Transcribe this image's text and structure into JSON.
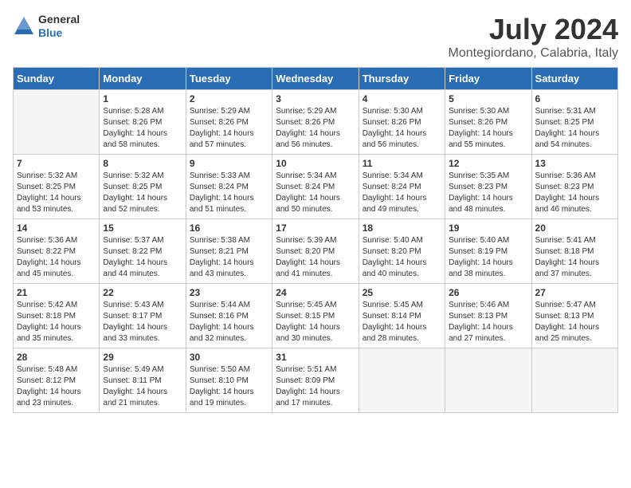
{
  "header": {
    "logo_general": "General",
    "logo_blue": "Blue",
    "main_title": "July 2024",
    "subtitle": "Montegiordano, Calabria, Italy"
  },
  "days_of_week": [
    "Sunday",
    "Monday",
    "Tuesday",
    "Wednesday",
    "Thursday",
    "Friday",
    "Saturday"
  ],
  "weeks": [
    [
      {
        "day": "",
        "sunrise": "",
        "sunset": "",
        "daylight": "",
        "empty": true
      },
      {
        "day": "1",
        "sunrise": "Sunrise: 5:28 AM",
        "sunset": "Sunset: 8:26 PM",
        "daylight": "Daylight: 14 hours and 58 minutes."
      },
      {
        "day": "2",
        "sunrise": "Sunrise: 5:29 AM",
        "sunset": "Sunset: 8:26 PM",
        "daylight": "Daylight: 14 hours and 57 minutes."
      },
      {
        "day": "3",
        "sunrise": "Sunrise: 5:29 AM",
        "sunset": "Sunset: 8:26 PM",
        "daylight": "Daylight: 14 hours and 56 minutes."
      },
      {
        "day": "4",
        "sunrise": "Sunrise: 5:30 AM",
        "sunset": "Sunset: 8:26 PM",
        "daylight": "Daylight: 14 hours and 56 minutes."
      },
      {
        "day": "5",
        "sunrise": "Sunrise: 5:30 AM",
        "sunset": "Sunset: 8:26 PM",
        "daylight": "Daylight: 14 hours and 55 minutes."
      },
      {
        "day": "6",
        "sunrise": "Sunrise: 5:31 AM",
        "sunset": "Sunset: 8:25 PM",
        "daylight": "Daylight: 14 hours and 54 minutes."
      }
    ],
    [
      {
        "day": "7",
        "sunrise": "Sunrise: 5:32 AM",
        "sunset": "Sunset: 8:25 PM",
        "daylight": "Daylight: 14 hours and 53 minutes."
      },
      {
        "day": "8",
        "sunrise": "Sunrise: 5:32 AM",
        "sunset": "Sunset: 8:25 PM",
        "daylight": "Daylight: 14 hours and 52 minutes."
      },
      {
        "day": "9",
        "sunrise": "Sunrise: 5:33 AM",
        "sunset": "Sunset: 8:24 PM",
        "daylight": "Daylight: 14 hours and 51 minutes."
      },
      {
        "day": "10",
        "sunrise": "Sunrise: 5:34 AM",
        "sunset": "Sunset: 8:24 PM",
        "daylight": "Daylight: 14 hours and 50 minutes."
      },
      {
        "day": "11",
        "sunrise": "Sunrise: 5:34 AM",
        "sunset": "Sunset: 8:24 PM",
        "daylight": "Daylight: 14 hours and 49 minutes."
      },
      {
        "day": "12",
        "sunrise": "Sunrise: 5:35 AM",
        "sunset": "Sunset: 8:23 PM",
        "daylight": "Daylight: 14 hours and 48 minutes."
      },
      {
        "day": "13",
        "sunrise": "Sunrise: 5:36 AM",
        "sunset": "Sunset: 8:23 PM",
        "daylight": "Daylight: 14 hours and 46 minutes."
      }
    ],
    [
      {
        "day": "14",
        "sunrise": "Sunrise: 5:36 AM",
        "sunset": "Sunset: 8:22 PM",
        "daylight": "Daylight: 14 hours and 45 minutes."
      },
      {
        "day": "15",
        "sunrise": "Sunrise: 5:37 AM",
        "sunset": "Sunset: 8:22 PM",
        "daylight": "Daylight: 14 hours and 44 minutes."
      },
      {
        "day": "16",
        "sunrise": "Sunrise: 5:38 AM",
        "sunset": "Sunset: 8:21 PM",
        "daylight": "Daylight: 14 hours and 43 minutes."
      },
      {
        "day": "17",
        "sunrise": "Sunrise: 5:39 AM",
        "sunset": "Sunset: 8:20 PM",
        "daylight": "Daylight: 14 hours and 41 minutes."
      },
      {
        "day": "18",
        "sunrise": "Sunrise: 5:40 AM",
        "sunset": "Sunset: 8:20 PM",
        "daylight": "Daylight: 14 hours and 40 minutes."
      },
      {
        "day": "19",
        "sunrise": "Sunrise: 5:40 AM",
        "sunset": "Sunset: 8:19 PM",
        "daylight": "Daylight: 14 hours and 38 minutes."
      },
      {
        "day": "20",
        "sunrise": "Sunrise: 5:41 AM",
        "sunset": "Sunset: 8:18 PM",
        "daylight": "Daylight: 14 hours and 37 minutes."
      }
    ],
    [
      {
        "day": "21",
        "sunrise": "Sunrise: 5:42 AM",
        "sunset": "Sunset: 8:18 PM",
        "daylight": "Daylight: 14 hours and 35 minutes."
      },
      {
        "day": "22",
        "sunrise": "Sunrise: 5:43 AM",
        "sunset": "Sunset: 8:17 PM",
        "daylight": "Daylight: 14 hours and 33 minutes."
      },
      {
        "day": "23",
        "sunrise": "Sunrise: 5:44 AM",
        "sunset": "Sunset: 8:16 PM",
        "daylight": "Daylight: 14 hours and 32 minutes."
      },
      {
        "day": "24",
        "sunrise": "Sunrise: 5:45 AM",
        "sunset": "Sunset: 8:15 PM",
        "daylight": "Daylight: 14 hours and 30 minutes."
      },
      {
        "day": "25",
        "sunrise": "Sunrise: 5:45 AM",
        "sunset": "Sunset: 8:14 PM",
        "daylight": "Daylight: 14 hours and 28 minutes."
      },
      {
        "day": "26",
        "sunrise": "Sunrise: 5:46 AM",
        "sunset": "Sunset: 8:13 PM",
        "daylight": "Daylight: 14 hours and 27 minutes."
      },
      {
        "day": "27",
        "sunrise": "Sunrise: 5:47 AM",
        "sunset": "Sunset: 8:13 PM",
        "daylight": "Daylight: 14 hours and 25 minutes."
      }
    ],
    [
      {
        "day": "28",
        "sunrise": "Sunrise: 5:48 AM",
        "sunset": "Sunset: 8:12 PM",
        "daylight": "Daylight: 14 hours and 23 minutes."
      },
      {
        "day": "29",
        "sunrise": "Sunrise: 5:49 AM",
        "sunset": "Sunset: 8:11 PM",
        "daylight": "Daylight: 14 hours and 21 minutes."
      },
      {
        "day": "30",
        "sunrise": "Sunrise: 5:50 AM",
        "sunset": "Sunset: 8:10 PM",
        "daylight": "Daylight: 14 hours and 19 minutes."
      },
      {
        "day": "31",
        "sunrise": "Sunrise: 5:51 AM",
        "sunset": "Sunset: 8:09 PM",
        "daylight": "Daylight: 14 hours and 17 minutes."
      },
      {
        "day": "",
        "sunrise": "",
        "sunset": "",
        "daylight": "",
        "empty": true
      },
      {
        "day": "",
        "sunrise": "",
        "sunset": "",
        "daylight": "",
        "empty": true
      },
      {
        "day": "",
        "sunrise": "",
        "sunset": "",
        "daylight": "",
        "empty": true
      }
    ]
  ]
}
